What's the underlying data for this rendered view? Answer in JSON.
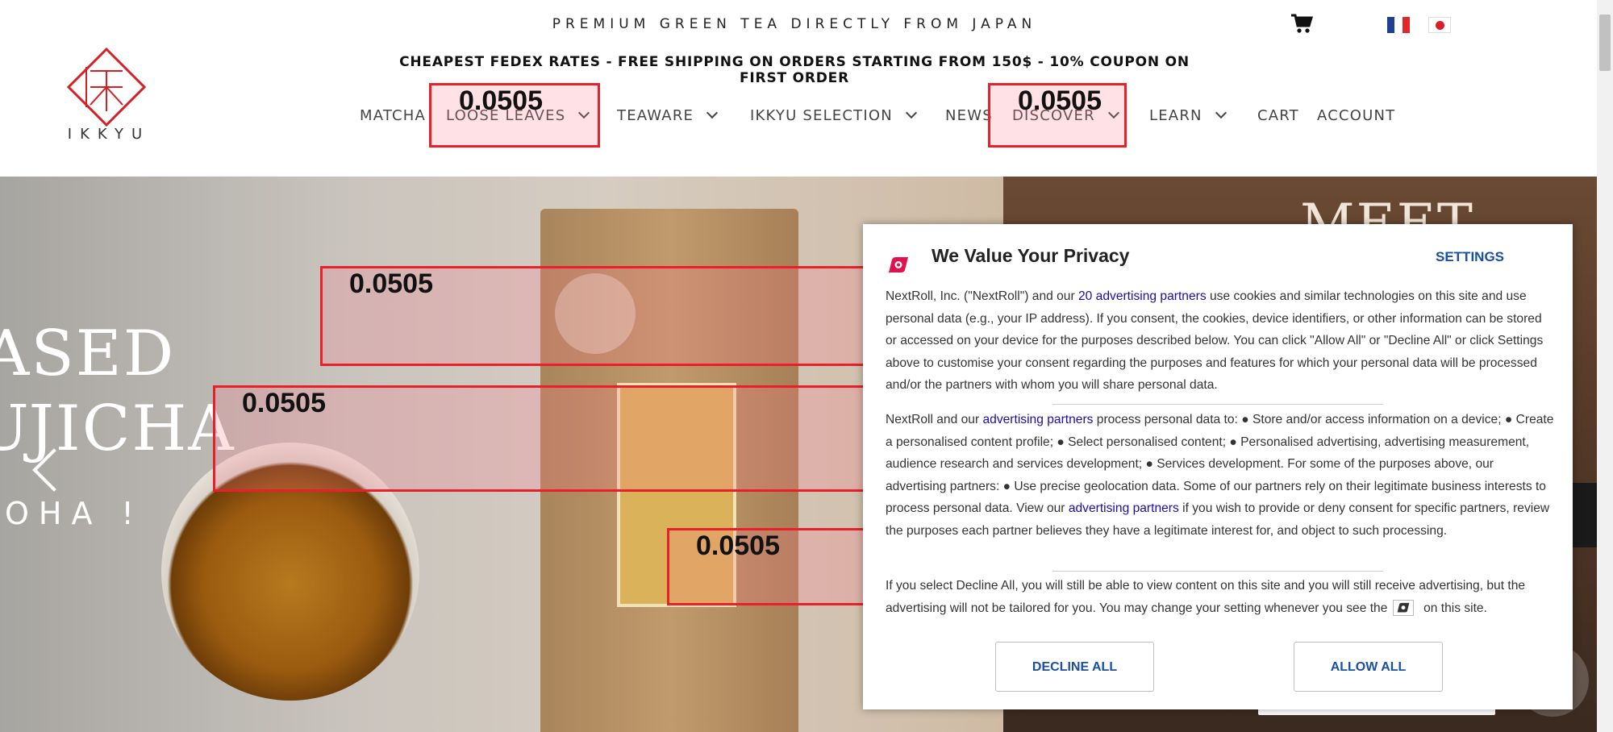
{
  "header": {
    "tagline": "PREMIUM GREEN TEA DIRECTLY FROM JAPAN",
    "shipping": "CHEAPEST FEDEX RATES - FREE SHIPPING ON ORDERS STARTING FROM 150$ - 10% COUPON ON FIRST ORDER",
    "logo_text": "IKKYU"
  },
  "nav": {
    "matcha": "MATCHA",
    "loose_leaves": "LOOSE LEAVES",
    "teaware": "TEAWARE",
    "ikkyu_selection": "IKKYU SELECTION",
    "news": "NEWS",
    "discover": "DISCOVER",
    "learn": "LEARN",
    "cart": "CART",
    "account": "ACCOUNT"
  },
  "highlights": {
    "value": "0.0505"
  },
  "hero": {
    "line1": "ASED",
    "line2": "UJICHA",
    "line3": "OHA !",
    "meet": "MEET OUR"
  },
  "privacy": {
    "title": "We Value Your Privacy",
    "settings": "SETTINGS",
    "p1_a": "NextRoll, Inc. (\"NextRoll\") and our ",
    "p1_link": "20 advertising partners",
    "p1_b": " use cookies and similar technologies on this site and use personal data (e.g., your IP address). If you consent, the cookies, device identifiers, or other information can be stored or accessed on your device for the purposes described below. You can click \"Allow All\" or \"Decline All\" or click Settings above to customise your consent regarding the purposes and features for which your personal data will be processed and/or the partners with whom you will share personal data.",
    "p2_a": "NextRoll and our ",
    "p2_link": "advertising partners",
    "p2_b": " process personal data to: ● Store and/or access information on a device; ● Create a personalised content profile; ● Select personalised content; ● Personalised advertising, advertising measurement, audience research and services development; ● Services development. For some of the purposes above, our advertising partners: ● Use precise geolocation data. Some of our partners rely on their legitimate business interests to process personal data. View our ",
    "p2_link2": "advertising partners",
    "p2_c": " if you wish to provide or deny consent for specific partners, review the purposes each partner believes they have a legitimate interest for, and object to such processing.",
    "p3_a": "If you select Decline All, you will still be able to view content on this site and you will still receive advertising, but the advertising will not be tailored for you. You may change your setting whenever you see the ",
    "p3_b": " on this site.",
    "decline": "DECLINE ALL",
    "allow": "ALLOW ALL"
  },
  "colors": {
    "brand_red": "#d61f26",
    "link_blue": "#1a0dab",
    "button_blue": "#1a4fa1",
    "highlight_border": "#e8202a"
  }
}
